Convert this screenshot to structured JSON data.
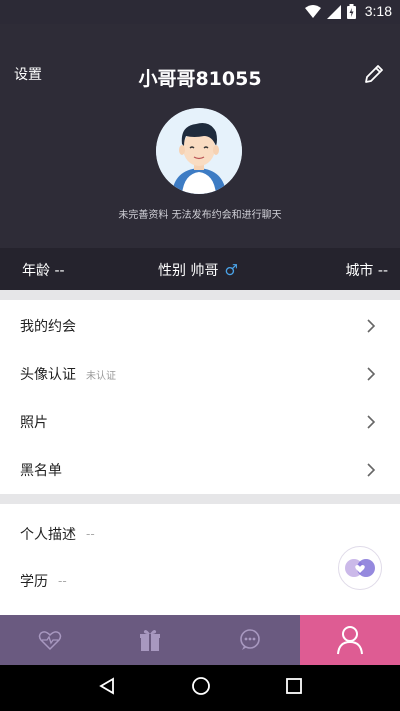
{
  "status_bar": {
    "time": "3:18"
  },
  "header": {
    "settings_label": "设置",
    "username": "小哥哥81055",
    "hint": "未完善资料 无法发布约会和进行聊天"
  },
  "info": {
    "age_label": "年龄 --",
    "gender_label": "性别 帅哥",
    "city_label": "城市 --",
    "gender_symbol": "♂"
  },
  "menu": [
    {
      "label": "我的约会"
    },
    {
      "label": "头像认证",
      "sub": "未认证"
    },
    {
      "label": "照片"
    },
    {
      "label": "黑名单"
    }
  ],
  "profile": [
    {
      "label": "个人描述",
      "value": "--"
    },
    {
      "label": "学历",
      "value": "--"
    }
  ],
  "colors": {
    "header_bg": "#2e2c37",
    "nav_bg": "#6a5a80",
    "nav_active": "#de5c93",
    "gender_blue": "#4aa3e8"
  }
}
